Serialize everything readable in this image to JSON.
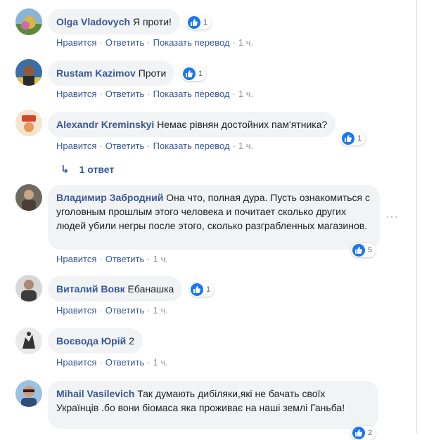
{
  "colors": {
    "author": "#385898",
    "link": "#385898",
    "meta": "#90949c",
    "bubble": "#f2f3f5",
    "like": "#1877f2"
  },
  "icons": {
    "like": "thumbs-up-icon",
    "reply": "reply-arrow-icon",
    "more": "more-options-icon"
  },
  "actions": {
    "like": "Нравится",
    "reply": "Ответить",
    "translate": "Показать перевод"
  },
  "comments": [
    {
      "author": "Olga Vladovych",
      "text": "Я проти!",
      "reactions": "1",
      "time": "1 ч."
    },
    {
      "author": "Rustam Kazimov",
      "text": "Проти",
      "reactions": "1",
      "time": "1 ч."
    },
    {
      "author": "Alexandr Kreminskyi",
      "text": "Немає рівнян достойних пам'ятника?",
      "reactions": "1",
      "time": "1 ч.",
      "replies": "1 ответ"
    },
    {
      "author": "Владимир Забродний",
      "text": "Она что, полная дура. Пусть ознакомиться с уголовным прошлым этого человека и почитает сколько других людей убили негры после этого, сколько разграбленных магазинов.",
      "reactions": "5",
      "time": "1 ч."
    },
    {
      "author": "Виталий Вовк",
      "text": "Ебанашка",
      "reactions": "1",
      "time": "1 ч."
    },
    {
      "author": "Воєвода Юрій",
      "text": "2",
      "time": "1 ч."
    },
    {
      "author": "Mihail Vasilevich",
      "text": "Так думають дибіляки,які не бачать своїх Українців .бо вони біомаса яка проживає на наші землі Ганьба!",
      "reactions": "2"
    }
  ]
}
